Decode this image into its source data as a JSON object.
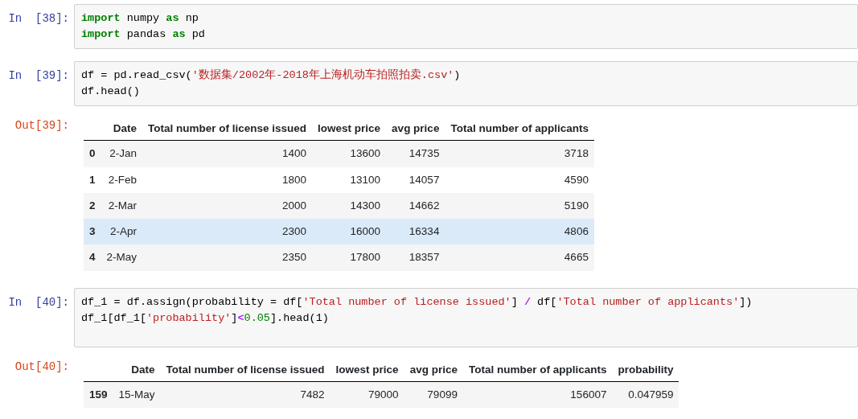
{
  "cells": [
    {
      "prompt": "In  [38]:",
      "lines": [
        [
          {
            "kind": "keyword",
            "text": "import"
          },
          {
            "kind": "plain",
            "text": " numpy "
          },
          {
            "kind": "keyword",
            "text": "as"
          },
          {
            "kind": "plain",
            "text": " np"
          }
        ],
        [
          {
            "kind": "keyword",
            "text": "import"
          },
          {
            "kind": "plain",
            "text": " pandas "
          },
          {
            "kind": "keyword",
            "text": "as"
          },
          {
            "kind": "plain",
            "text": " pd"
          }
        ]
      ]
    },
    {
      "prompt": "In  [39]:",
      "lines": [
        [
          {
            "kind": "plain",
            "text": "df = pd.read_csv("
          },
          {
            "kind": "string",
            "text": "'数据集/2002年-2018年上海机动车拍照拍卖.csv'"
          },
          {
            "kind": "plain",
            "text": ")"
          }
        ],
        [
          {
            "kind": "plain",
            "text": "df.head()"
          }
        ]
      ],
      "output": {
        "prompt": "Out[39]:",
        "columns": [
          "Date",
          "Total number of license issued",
          "lowest price",
          "avg price",
          "Total number of applicants"
        ],
        "rows": [
          {
            "index": "0",
            "cells": [
              "2-Jan",
              "1400",
              "13600",
              "14735",
              "3718"
            ],
            "selected": false
          },
          {
            "index": "1",
            "cells": [
              "2-Feb",
              "1800",
              "13100",
              "14057",
              "4590"
            ],
            "selected": false
          },
          {
            "index": "2",
            "cells": [
              "2-Mar",
              "2000",
              "14300",
              "14662",
              "5190"
            ],
            "selected": false
          },
          {
            "index": "3",
            "cells": [
              "2-Apr",
              "2300",
              "16000",
              "16334",
              "4806"
            ],
            "selected": true
          },
          {
            "index": "4",
            "cells": [
              "2-May",
              "2350",
              "17800",
              "18357",
              "4665"
            ],
            "selected": false
          }
        ]
      }
    },
    {
      "prompt": "In  [40]:",
      "lines": [
        [
          {
            "kind": "plain",
            "text": "df_1 = df.assign(probability = df["
          },
          {
            "kind": "string",
            "text": "'Total number of license issued'"
          },
          {
            "kind": "plain",
            "text": "] "
          },
          {
            "kind": "operator",
            "text": "/"
          },
          {
            "kind": "plain",
            "text": " df["
          },
          {
            "kind": "string",
            "text": "'Total number of applicants'"
          },
          {
            "kind": "plain",
            "text": "])"
          }
        ],
        [
          {
            "kind": "plain",
            "text": "df_1[df_1["
          },
          {
            "kind": "string",
            "text": "'probability'"
          },
          {
            "kind": "plain",
            "text": "]"
          },
          {
            "kind": "operator",
            "text": "<"
          },
          {
            "kind": "number",
            "text": "0.05"
          },
          {
            "kind": "plain",
            "text": "].head(1)"
          }
        ]
      ],
      "output": {
        "prompt": "Out[40]:",
        "columns": [
          "Date",
          "Total number of license issued",
          "lowest price",
          "avg price",
          "Total number of applicants",
          "probability"
        ],
        "rows": [
          {
            "index": "159",
            "cells": [
              "15-May",
              "7482",
              "79000",
              "79099",
              "156007",
              "0.047959"
            ],
            "selected": false
          }
        ]
      }
    }
  ]
}
